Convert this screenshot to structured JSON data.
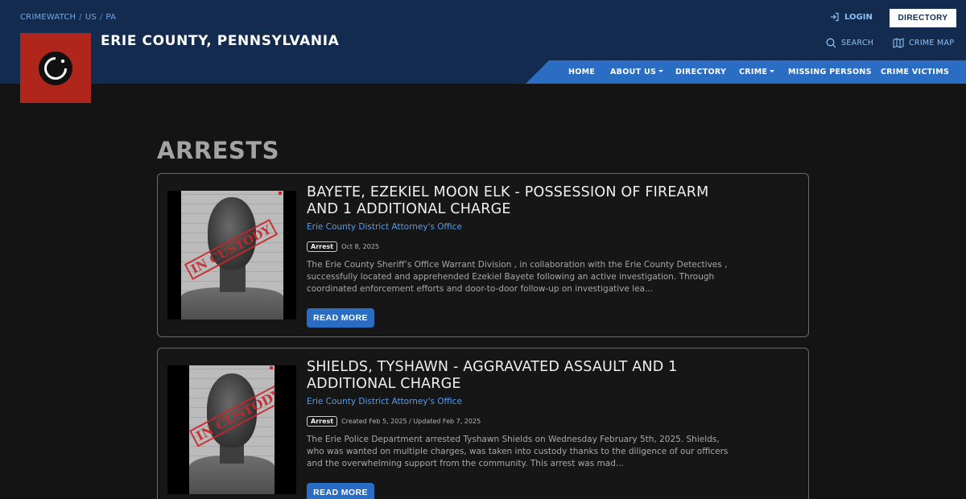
{
  "breadcrumb": [
    "CRIMEWATCH",
    "US",
    "PA"
  ],
  "site_title": "ERIE COUNTY, PENNSYLVANIA",
  "header_actions": {
    "login": "LOGIN",
    "directory": "DIRECTORY"
  },
  "utility_links": {
    "search": "SEARCH",
    "crime_map": "CRIME MAP"
  },
  "nav": [
    {
      "label": "HOME",
      "dropdown": false
    },
    {
      "label": "ABOUT US",
      "dropdown": true
    },
    {
      "label": "DIRECTORY",
      "dropdown": false
    },
    {
      "label": "CRIME",
      "dropdown": true
    },
    {
      "label": "MISSING PERSONS",
      "dropdown": false
    },
    {
      "label": "CRIME VICTIMS",
      "dropdown": false
    }
  ],
  "page_heading": "ARRESTS",
  "arrests": [
    {
      "title": "BAYETE, EZEKIEL MOON ELK - POSSESSION OF FIREARM AND 1 ADDITIONAL CHARGE",
      "agency": "Erie County District Attorney's Office",
      "badge": "Arrest",
      "date": "Oct 8, 2025",
      "stamp": "IN CUSTODY",
      "excerpt": "The Erie County Sheriff’s Office Warrant Division , in collaboration with the Erie County Detectives , successfully located and apprehended Ezekiel Bayete following an active investigation. Through coordinated enforcement efforts and door-to-door follow-up on investigative lea...",
      "button": "READ MORE"
    },
    {
      "title": "SHIELDS, TYSHAWN - AGGRAVATED ASSAULT AND 1 ADDITIONAL CHARGE",
      "agency": "Erie County District Attorney's Office",
      "badge": "Arrest",
      "date": "Created Feb 5, 2025 / Updated Feb 7, 2025",
      "stamp": "IN CUSTODY",
      "excerpt": "The Erie Police Department arrested Tyshawn Shields on Wednesday February 5th, 2025.  Shields, who was wanted on multiple charges, was taken into custody thanks to the diligence of our officers and the overwhelming support from the community. This arrest was mad...",
      "button": "READ MORE"
    }
  ],
  "colors": {
    "header": "#132b4f",
    "nav": "#2b6dc2",
    "logo": "#b0261d",
    "stamp": "#c8262a"
  }
}
